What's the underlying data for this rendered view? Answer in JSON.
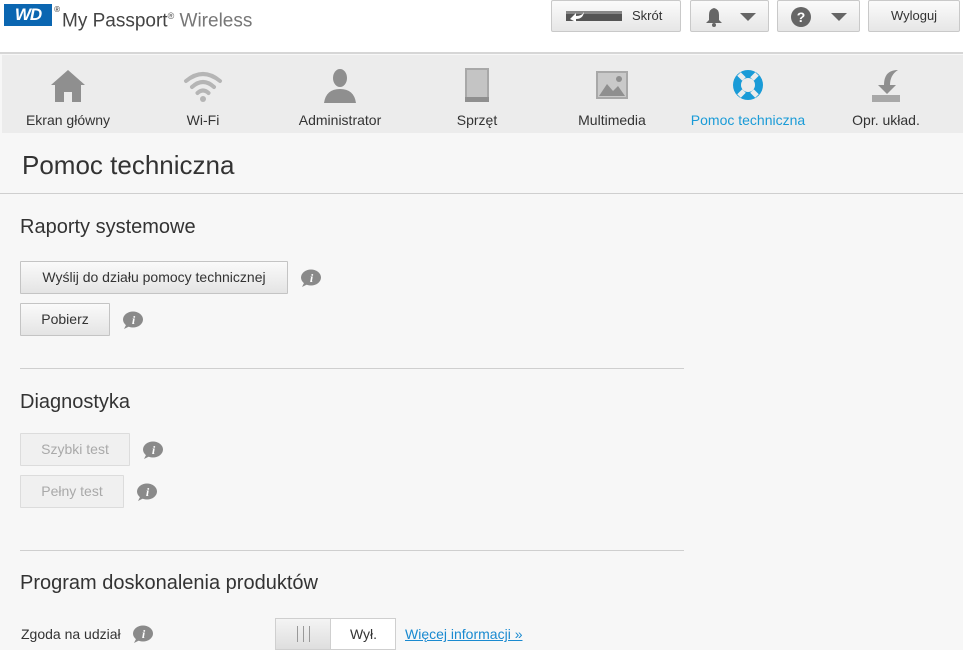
{
  "brand": {
    "logo_text": "WD",
    "logo_tm": "®",
    "name": "My Passport",
    "reg": "®",
    "product": "Wireless"
  },
  "toolbar": {
    "shortcut_label": "Skrót",
    "logout_label": "Wyloguj",
    "bell_icon": "bell-icon",
    "help_icon": "question-circle-icon"
  },
  "nav": {
    "items": [
      {
        "label": "Ekran główny",
        "icon": "home-icon",
        "active": false
      },
      {
        "label": "Wi-Fi",
        "icon": "wifi-icon",
        "active": false
      },
      {
        "label": "Administrator",
        "icon": "user-icon",
        "active": false
      },
      {
        "label": "Sprzęt",
        "icon": "drive-icon",
        "active": false
      },
      {
        "label": "Multimedia",
        "icon": "image-icon",
        "active": false
      },
      {
        "label": "Pomoc techniczna",
        "icon": "lifebuoy-icon",
        "active": true
      },
      {
        "label": "Opr. układ.",
        "icon": "firmware-download-icon",
        "active": false
      }
    ],
    "active_color": "#1a9bd7"
  },
  "page": {
    "title": "Pomoc techniczna"
  },
  "reports": {
    "title": "Raporty systemowe",
    "send_label": "Wyślij do działu pomocy technicznej",
    "download_label": "Pobierz"
  },
  "diagnostics": {
    "title": "Diagnostyka",
    "quick_label": "Szybki test",
    "full_label": "Pełny test"
  },
  "program": {
    "title": "Program doskonalenia produktów",
    "consent_label": "Zgoda na udział",
    "toggle_state": "Wył.",
    "more_info": "Więcej informacji »"
  }
}
